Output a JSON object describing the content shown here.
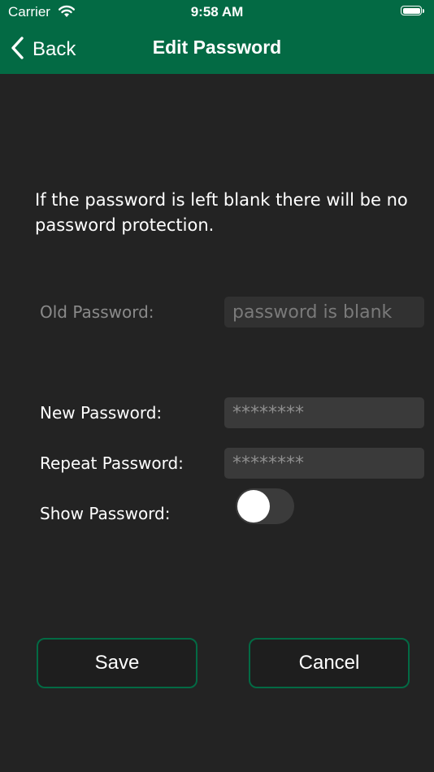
{
  "status_bar": {
    "carrier": "Carrier",
    "time": "9:58 AM"
  },
  "nav": {
    "back_label": "Back",
    "title": "Edit Password"
  },
  "info": {
    "text": "If the password is left blank there will be no password protection."
  },
  "form": {
    "old_password": {
      "label": "Old Password:",
      "placeholder": "password is blank"
    },
    "new_password": {
      "label": "New Password:",
      "placeholder": "********"
    },
    "repeat_password": {
      "label": "Repeat Password:",
      "placeholder": "********"
    },
    "show_password": {
      "label": "Show Password:",
      "on": false
    }
  },
  "actions": {
    "save_label": "Save",
    "cancel_label": "Cancel"
  },
  "colors": {
    "header": "#036a44",
    "background": "#232323",
    "button_border": "#036a44"
  }
}
